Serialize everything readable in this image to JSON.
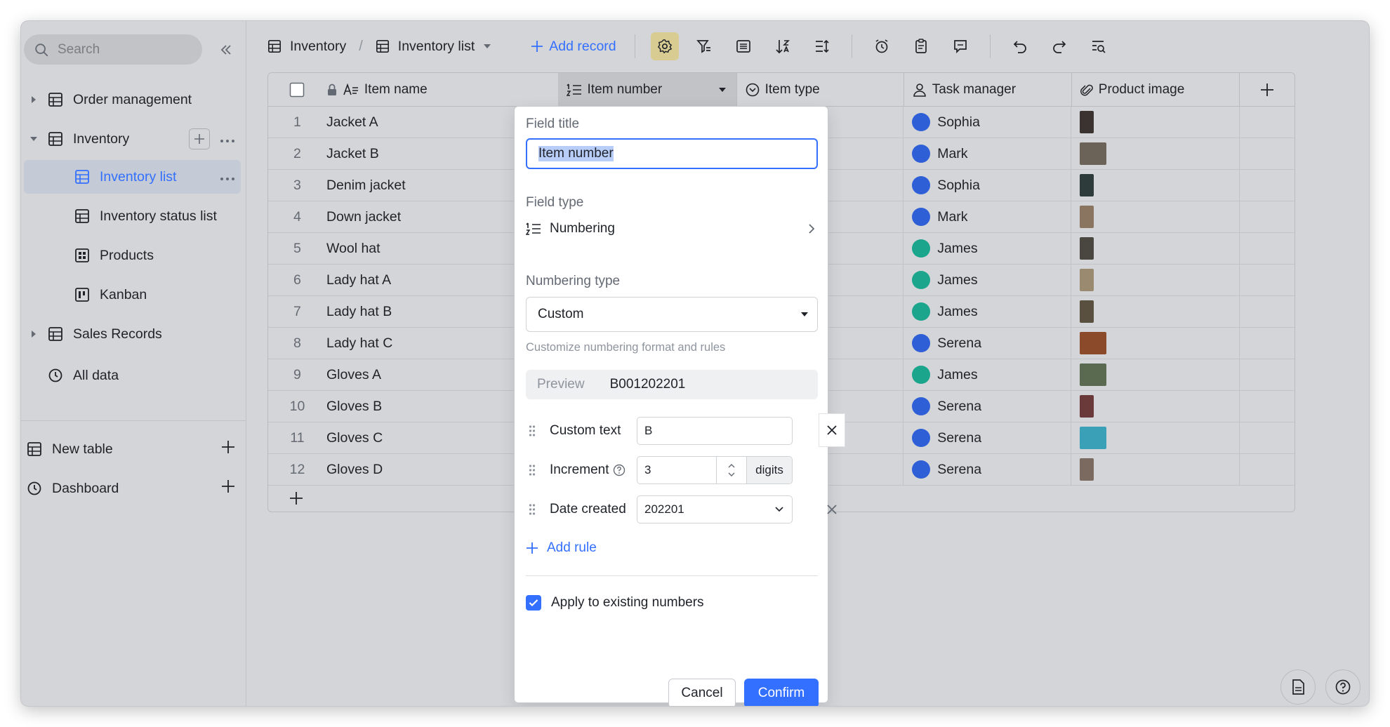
{
  "sidebar": {
    "search_placeholder": "Search",
    "items": [
      {
        "label": "Order management"
      },
      {
        "label": "Inventory"
      },
      {
        "label": "Inventory list"
      },
      {
        "label": "Inventory status list"
      },
      {
        "label": "Products"
      },
      {
        "label": "Kanban"
      },
      {
        "label": "Sales Records"
      },
      {
        "label": "All data"
      }
    ],
    "new_table": "New table",
    "dashboard": "Dashboard"
  },
  "toolbar": {
    "crumb_table": "Inventory",
    "crumb_sep": "/",
    "crumb_view": "Inventory list",
    "add_record": "Add record"
  },
  "grid": {
    "columns": [
      "Item name",
      "Item number",
      "Item type",
      "Task manager",
      "Product image"
    ],
    "rows": [
      {
        "idx": "1",
        "name": "Jacket A",
        "manager": "Sophia",
        "avatar": "blue"
      },
      {
        "idx": "2",
        "name": "Jacket B",
        "manager": "Mark",
        "avatar": "blue"
      },
      {
        "idx": "3",
        "name": "Denim jacket",
        "manager": "Sophia",
        "avatar": "blue"
      },
      {
        "idx": "4",
        "name": "Down jacket",
        "manager": "Mark",
        "avatar": "blue"
      },
      {
        "idx": "5",
        "name": "Wool hat",
        "manager": "James",
        "avatar": "teal"
      },
      {
        "idx": "6",
        "name": "Lady hat A",
        "manager": "James",
        "avatar": "teal"
      },
      {
        "idx": "7",
        "name": "Lady hat B",
        "manager": "James",
        "avatar": "teal"
      },
      {
        "idx": "8",
        "name": "Lady hat C",
        "manager": "Serena",
        "avatar": "blue"
      },
      {
        "idx": "9",
        "name": "Gloves A",
        "manager": "James",
        "avatar": "teal"
      },
      {
        "idx": "10",
        "name": "Gloves B",
        "manager": "Serena",
        "avatar": "blue"
      },
      {
        "idx": "11",
        "name": "Gloves C",
        "manager": "Serena",
        "avatar": "blue"
      },
      {
        "idx": "12",
        "name": "Gloves D",
        "manager": "Serena",
        "avatar": "blue"
      }
    ]
  },
  "popup": {
    "field_title_label": "Field title",
    "field_title_value": "Item number",
    "field_type_label": "Field type",
    "field_type_value": "Numbering",
    "numbering_type_label": "Numbering type",
    "numbering_type_value": "Custom",
    "numbering_hint": "Customize numbering format and rules",
    "preview_label": "Preview",
    "preview_value": "B001202201",
    "rules": {
      "custom_text_label": "Custom text",
      "custom_text_value": "B",
      "increment_label": "Increment",
      "increment_value": "3",
      "increment_unit": "digits",
      "date_label": "Date created",
      "date_value": "202201"
    },
    "add_rule": "Add rule",
    "apply_existing": "Apply to existing numbers",
    "cancel": "Cancel",
    "confirm": "Confirm"
  },
  "colors": {
    "accent": "#3370ff",
    "avatar_blue": "#2e5fd6",
    "avatar_teal": "#1aa58c"
  }
}
